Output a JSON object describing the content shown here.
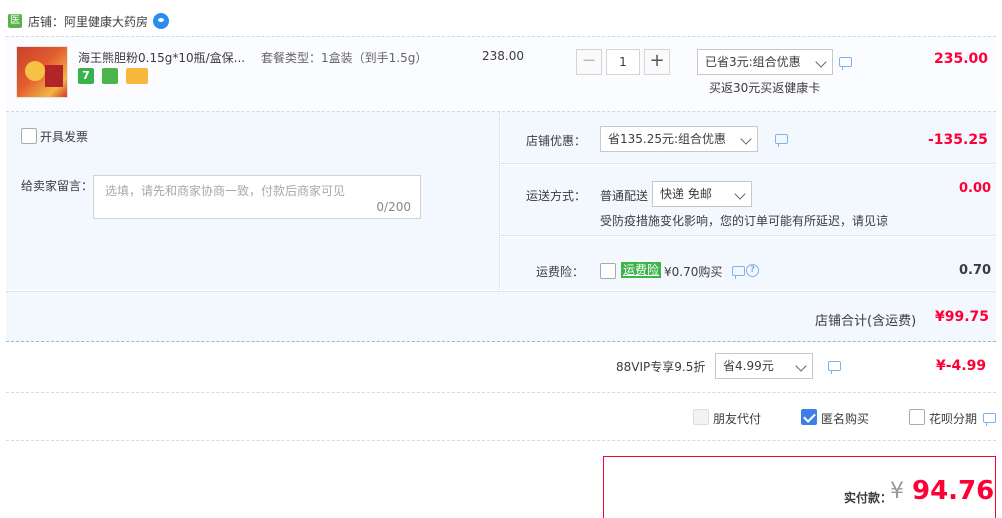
{
  "shop": {
    "badge": "医",
    "label": "店铺：阿里健康大药房"
  },
  "item": {
    "title": "海王熊胆粉0.15g*10瓶/盒保...",
    "tag_7": "7",
    "sku": "套餐类型：1盒装（到手1.5g）",
    "unit_price": "238.00",
    "quantity": "1",
    "promo_select": "已省3元:组合优惠",
    "promo_note": "买返30元买返健康卡",
    "subtotal": "235.00"
  },
  "invoice": {
    "label": "开具发票",
    "checked": false
  },
  "seller_message": {
    "label": "给卖家留言：",
    "placeholder": "选填，请先和商家协商一致，付款后商家可见",
    "counter": "0/200"
  },
  "shop_discount": {
    "label": "店铺优惠：",
    "select": "省135.25元:组合优惠",
    "amount": "-135.25"
  },
  "shipping": {
    "label": "运送方式：",
    "method": "普通配送",
    "select": "快递 免邮",
    "notice": "受防疫措施变化影响，您的订单可能有所延迟，请见谅",
    "amount": "0.00"
  },
  "shipping_insurance": {
    "label": "运费险：",
    "tag": "运费险",
    "price_text": "¥0.70购买",
    "amount": "0.70"
  },
  "shop_total": {
    "label": "店铺合计(含运费)",
    "amount": "¥99.75"
  },
  "vip": {
    "label": "88VIP专享9.5折",
    "select": "省4.99元",
    "amount": "¥-4.99"
  },
  "options": [
    {
      "label": "朋友代付",
      "state": "disabled"
    },
    {
      "label": "匿名购买",
      "state": "checked"
    },
    {
      "label": "花呗分期",
      "state": "unchecked"
    }
  ],
  "payment": {
    "label": "实付款：",
    "currency": "¥",
    "amount": "94.76"
  },
  "colors": {
    "price_red": "#ff0036",
    "panel_bg": "#f3f7fe",
    "accent_blue": "#3d7eea"
  }
}
